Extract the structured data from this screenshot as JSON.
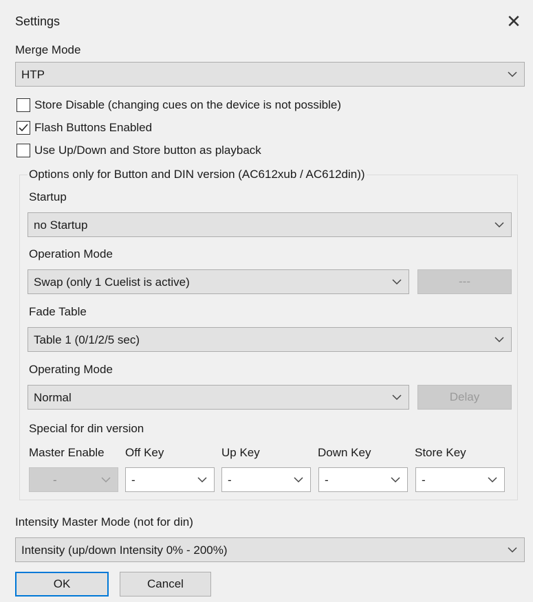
{
  "window": {
    "title": "Settings"
  },
  "merge_mode": {
    "label": "Merge Mode",
    "value": "HTP"
  },
  "checkboxes": [
    {
      "label": "Store Disable (changing cues on the device is not possible)",
      "checked": false
    },
    {
      "label": "Flash Buttons Enabled",
      "checked": true
    },
    {
      "label": "Use Up/Down and Store button as playback",
      "checked": false
    }
  ],
  "options_group": {
    "legend": "Options only for Button and DIN version (AC612xub / AC612din))",
    "startup": {
      "label": "Startup",
      "value": "no Startup"
    },
    "operation_mode": {
      "label": "Operation Mode",
      "value": "Swap (only 1 Cuelist is active)",
      "button": "---"
    },
    "fade_table": {
      "label": "Fade Table",
      "value": "Table 1 (0/1/2/5 sec)"
    },
    "operating_mode": {
      "label": "Operating Mode",
      "value": "Normal",
      "button": "Delay"
    },
    "din": {
      "label": "Special for din version",
      "keys": [
        {
          "label": "Master Enable",
          "value": "-"
        },
        {
          "label": "Off Key",
          "value": "-"
        },
        {
          "label": "Up Key",
          "value": "-"
        },
        {
          "label": "Down Key",
          "value": "-"
        },
        {
          "label": "Store Key",
          "value": "-"
        }
      ]
    }
  },
  "intensity": {
    "label": "Intensity Master Mode (not for din)",
    "value": "Intensity (up/down Intensity 0% - 200%)"
  },
  "buttons": {
    "ok": "OK",
    "cancel": "Cancel"
  }
}
